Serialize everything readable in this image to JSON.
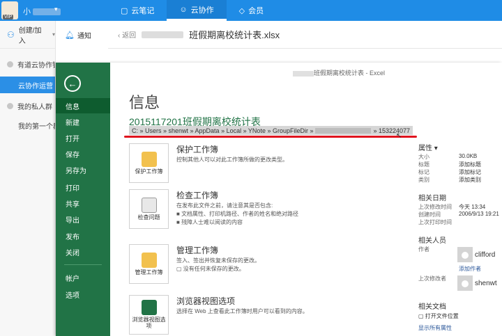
{
  "topbar": {
    "vip_badge": "VIP",
    "username": "小",
    "tabs": [
      {
        "label": "云笔记",
        "icon": "cloud-note-icon"
      },
      {
        "label": "云协作",
        "icon": "people-icon",
        "active": true
      },
      {
        "label": "会员",
        "icon": "diamond-icon"
      }
    ]
  },
  "sidebar": {
    "create_label": "创建/加入",
    "notify_label": "通知",
    "items": [
      {
        "label": "有道云协作销售部",
        "type": "group"
      },
      {
        "label": "云协作运营",
        "type": "active"
      },
      {
        "label": "我的私人群",
        "type": "group"
      },
      {
        "label": "我的第一个群",
        "type": "sub"
      }
    ]
  },
  "doc_header": {
    "back_label": "返回",
    "title_suffix": "班假期离校统计表.xlsx"
  },
  "excel": {
    "window_title_suffix": "班假期离校统计表 - Excel",
    "nav": [
      "信息",
      "新建",
      "打开",
      "保存",
      "另存为",
      "打印",
      "共享",
      "导出",
      "发布",
      "关闭",
      "帐户",
      "选项"
    ],
    "heading": "信息",
    "file_title": "2015117201班假期离校统计表",
    "path_prefix": "C: » Users » shenwt » AppData » Local » YNote » GroupFileDir »",
    "path_suffix": "» 153224077",
    "sections": {
      "protect": {
        "button": "保护工作簿",
        "title": "保护工作簿",
        "desc": "控制其他人可以对此工作簿所做的更改类型。"
      },
      "inspect": {
        "button": "检查问题",
        "title": "检查工作簿",
        "desc": "在发布此文件之前，请注意其是否包含:",
        "bullets": [
          "文档属性、打印机路径、作者的姓名和绝对路径",
          "残障人士难以阅读的内容"
        ]
      },
      "manage": {
        "button": "管理工作簿",
        "title": "管理工作簿",
        "desc": "签入、签出并恢复未保存的更改。",
        "note": "没有任何未保存的更改。"
      },
      "browser": {
        "button": "浏览器视图选项",
        "title": "浏览器视图选项",
        "desc": "选择在 Web 上查看此工作簿时用户可以看到的内容。"
      }
    },
    "properties": {
      "header": "属性",
      "rows": [
        {
          "k": "大小",
          "v": "30.0KB"
        },
        {
          "k": "标题",
          "v": "添加标题"
        },
        {
          "k": "标记",
          "v": "添加标记"
        },
        {
          "k": "类别",
          "v": "添加类别"
        }
      ],
      "dates_header": "相关日期",
      "dates": [
        {
          "k": "上次修改时间",
          "v": "今天 13:34"
        },
        {
          "k": "创建时间",
          "v": "2006/9/13 19:21"
        },
        {
          "k": "上次打印时间",
          "v": ""
        }
      ],
      "people_header": "相关人员",
      "author_label": "作者",
      "author_name": "clifford",
      "add_author": "添加作者",
      "modifier_label": "上次修改者",
      "modifier_name": "shenwt",
      "docs_header": "相关文档",
      "open_location": "打开文件位置",
      "show_all": "显示所有属性"
    }
  }
}
